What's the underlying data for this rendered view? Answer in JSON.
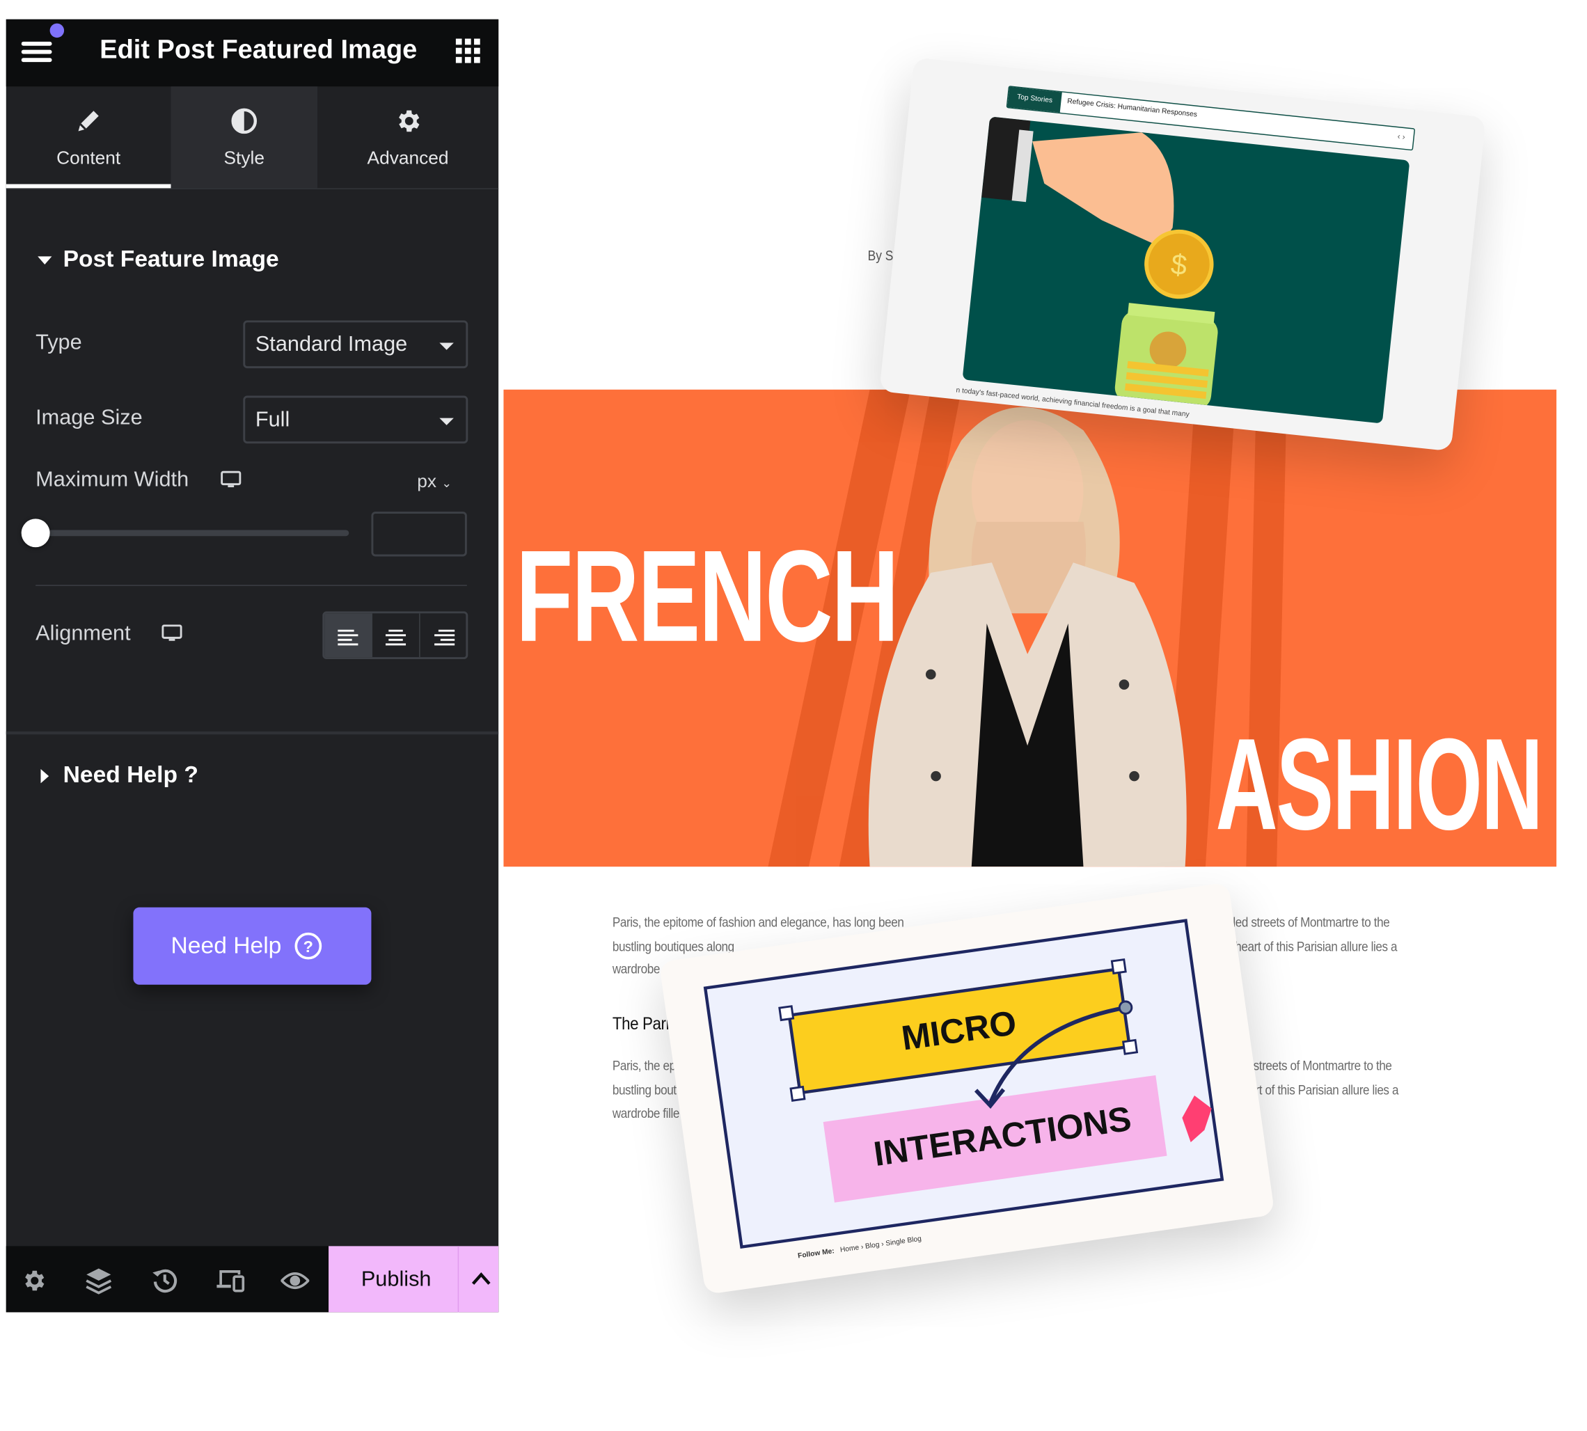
{
  "header": {
    "title": "Edit Post Featured Image",
    "menu_icon": "hamburger-icon",
    "apps_icon": "grid-icon",
    "notification_color": "#7f72fb"
  },
  "tabs": [
    {
      "label": "Content",
      "icon": "pencil-icon",
      "active": true
    },
    {
      "label": "Style",
      "icon": "half-circle-icon",
      "active": false
    },
    {
      "label": "Advanced",
      "icon": "gear-icon",
      "active": false
    }
  ],
  "section": {
    "title": "Post Feature Image",
    "type": {
      "label": "Type",
      "value": "Standard Image"
    },
    "image_size": {
      "label": "Image Size",
      "value": "Full"
    },
    "max_width": {
      "label": "Maximum Width",
      "unit": "px",
      "slider_value": 0,
      "input_value": ""
    },
    "alignment": {
      "label": "Alignment",
      "options": [
        "left",
        "center",
        "right"
      ],
      "selected": "left"
    }
  },
  "help_section": {
    "title": "Need Help ?",
    "button_label": "Need Help"
  },
  "footer": {
    "publish_label": "Publish",
    "icons": [
      "gear-icon",
      "layers-icon",
      "history-icon",
      "responsive-icon",
      "eye-icon"
    ],
    "publish_color": "#f2b8fb"
  },
  "accent_color": "#8272fb",
  "preview": {
    "byline": "By So",
    "hero_word_1": "FRENCH",
    "hero_word_2": "ASHION",
    "hero_color": "#fe703a",
    "top_card": {
      "ticker_label": "Top Stories",
      "ticker_headline": "Refugee Crisis: Humanitarian Responses",
      "ticker_nav": "‹ ›",
      "excerpt": "n today's fast-paced world, achieving financial freedom is a goal that many"
    },
    "article": {
      "lines_left": [
        "Paris, the epitome of fashion and elegance, has long been",
        "bustling boutiques along",
        "wardrobe"
      ],
      "heading": "The Paris",
      "lines_left_2": [
        "Paris, the ep",
        "bustling bout",
        "wardrobe fille"
      ],
      "lines_right": [
        "led streets of Montmartre to the",
        "heart of this Parisian allure lies a"
      ],
      "lines_right_2": [
        "streets of Montmartre to the",
        "rt of this Parisian allure lies a"
      ]
    },
    "bottom_card": {
      "word_1": "MICRO",
      "word_2": "INTERACTIONS",
      "breadcrumb": [
        "Follow Me:",
        "Home",
        "Blog",
        "Single Blog"
      ]
    }
  }
}
